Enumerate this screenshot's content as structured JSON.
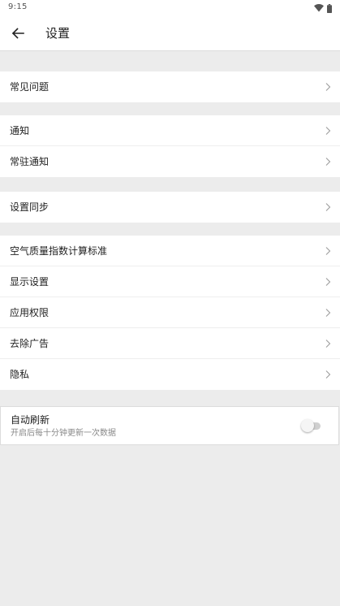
{
  "status_bar": {
    "time": "9:15",
    "icons": [
      "wifi-icon",
      "battery-icon"
    ]
  },
  "app_bar": {
    "back_icon": "arrow-left-icon",
    "title": "设置"
  },
  "groups": [
    {
      "items": [
        {
          "label": "常见问题"
        }
      ]
    },
    {
      "items": [
        {
          "label": "通知"
        },
        {
          "label": "常驻通知"
        }
      ]
    },
    {
      "items": [
        {
          "label": "设置同步"
        }
      ]
    },
    {
      "items": [
        {
          "label": "空气质量指数计算标准"
        },
        {
          "label": "显示设置"
        },
        {
          "label": "应用权限"
        },
        {
          "label": "去除广告"
        },
        {
          "label": "隐私"
        }
      ]
    }
  ],
  "auto_refresh": {
    "title": "自动刷新",
    "subtitle": "开启后每十分钟更新一次数据",
    "enabled": false
  },
  "colors": {
    "background": "#ececec",
    "surface": "#ffffff",
    "text": "#222222",
    "subtext": "#888888",
    "chevron": "#9e9e9e"
  }
}
